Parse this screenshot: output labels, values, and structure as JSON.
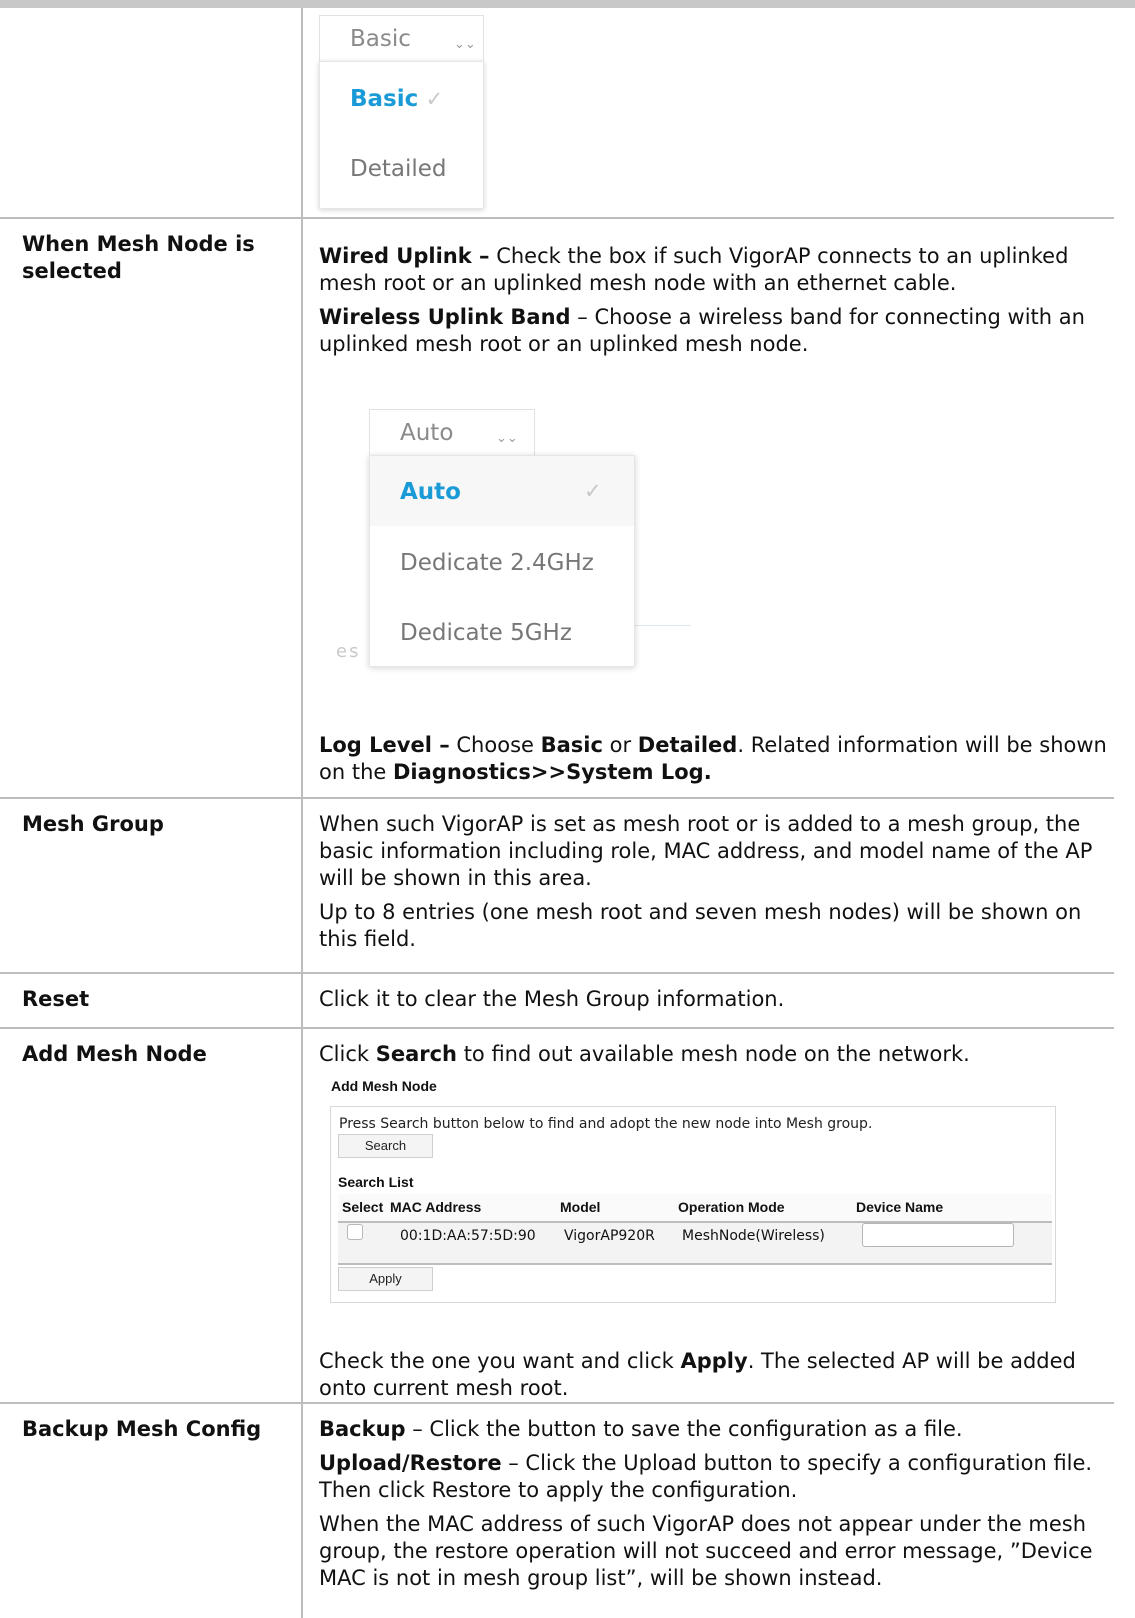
{
  "log_level_dropdown": {
    "current": "Basic",
    "options": [
      {
        "label": "Basic",
        "selected": true
      },
      {
        "label": "Detailed",
        "selected": false
      }
    ]
  },
  "rows": {
    "mesh_node": {
      "label": "When Mesh Node is selected",
      "wired_uplink_term": "Wired Uplink –",
      "wired_uplink_text": " Check the box if such VigorAP connects to an uplinked mesh root or an uplinked mesh node with an ethernet cable.",
      "wireless_band_term": "Wireless Uplink Band",
      "wireless_band_text": " – Choose a wireless band for connecting with an uplinked mesh root or an uplinked mesh node.",
      "band_dropdown": {
        "current": "Auto",
        "options": [
          {
            "label": "Auto",
            "selected": true
          },
          {
            "label": "Dedicate 2.4GHz",
            "selected": false
          },
          {
            "label": "Dedicate 5GHz",
            "selected": false
          }
        ],
        "ghost_text": "es"
      },
      "log_term": "Log Level –",
      "log_text1": " Choose ",
      "log_basic": "Basic",
      "log_text2": " or ",
      "log_detailed": "Detailed",
      "log_text3": ". Related information will be shown on the ",
      "log_link": "Diagnostics>>System Log."
    },
    "mesh_group": {
      "label": "Mesh Group",
      "p1": "When such VigorAP is set as mesh root or is added to a mesh group, the basic information including role, MAC address, and model name of the AP will be shown in this area.",
      "p2": "Up to 8 entries (one mesh root and seven mesh nodes) will be shown on this field."
    },
    "reset": {
      "label": "Reset",
      "text": "Click it to clear the Mesh Group information."
    },
    "add_mesh_node": {
      "label": "Add Mesh Node",
      "intro1": "Click ",
      "intro_term": "Search",
      "intro2": " to find out available mesh node on the network.",
      "panel": {
        "title": "Add Mesh Node",
        "hint": "Press Search button below to find and adopt the new node into Mesh group.",
        "search_button": "Search",
        "search_list_label": "Search List",
        "columns": [
          "Select",
          "MAC Address",
          "Model",
          "Operation Mode",
          "Device Name"
        ],
        "rows": [
          {
            "mac": "00:1D:AA:57:5D:90",
            "model": "VigorAP920R",
            "mode": "MeshNode(Wireless)",
            "device_name": ""
          }
        ],
        "apply_button": "Apply"
      },
      "outro1": "Check the one you want and click ",
      "outro_term": "Apply",
      "outro2": ". The selected AP will be added onto current mesh root."
    },
    "backup": {
      "label": "Backup Mesh Config",
      "backup_term": "Backup",
      "backup_text": " – Click the button to save the configuration as a file.",
      "upload_term": "Upload/Restore",
      "upload_text": " – Click the Upload button to specify a configuration file. Then click Restore to apply the configuration.",
      "p3": "When the MAC address of such VigorAP does not appear under the mesh group, the restore operation will not succeed and error message, ”Device MAC is not in mesh group list”, will be shown instead."
    }
  }
}
